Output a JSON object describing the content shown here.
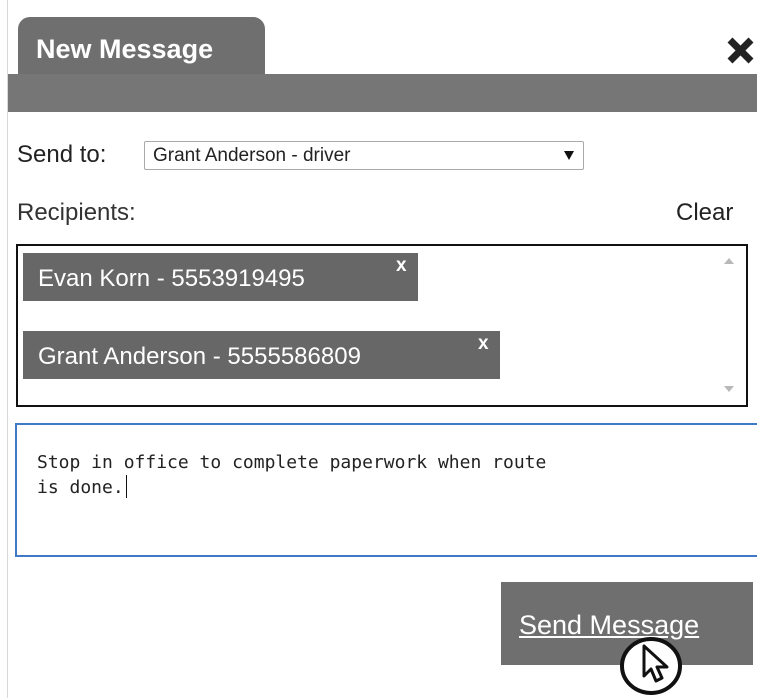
{
  "dialog": {
    "title": "New Message"
  },
  "send_to": {
    "label": "Send to:",
    "selected": "Grant Anderson - driver"
  },
  "recipients": {
    "label": "Recipients:",
    "clear_label": "Clear",
    "items": [
      {
        "label": "Evan Korn - 5553919495",
        "remove_label": "x"
      },
      {
        "label": "Grant Anderson - 5555586809",
        "remove_label": "x"
      }
    ]
  },
  "message": {
    "value": "Stop in office to complete paperwork when route\nis done."
  },
  "actions": {
    "send_label": "Send Message"
  },
  "icons": {
    "close": "close-icon",
    "dropdown": "dropdown-arrow-icon",
    "scroll_up": "scroll-up-icon",
    "scroll_down": "scroll-down-icon",
    "cursor": "hand-cursor-icon"
  },
  "colors": {
    "header": "#767676",
    "chip": "#676767",
    "button": "#6f6f6f",
    "focus_border": "#3f79c8",
    "text_on_dark": "#ffffff"
  }
}
